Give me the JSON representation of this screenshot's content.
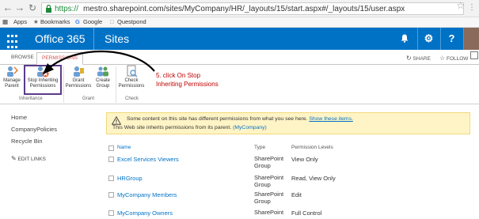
{
  "browser": {
    "url_scheme": "https://",
    "url_rest": "mestro.sharepoint.com/sites/MyCompany/HR/_layouts/15/start.aspx#/_layouts/15/user.aspx",
    "bookmarks": [
      "Apps",
      "Bookmarks",
      "Google",
      "Questpond"
    ]
  },
  "suite": {
    "app_name": "Office 365",
    "section": "Sites",
    "accent": "#0072c6"
  },
  "ribbon": {
    "tabs": [
      "BROWSE",
      "PERMISSIONS"
    ],
    "active_tab": "PERMISSIONS",
    "share": "SHARE",
    "follow": "FOLLOW",
    "buttons": {
      "manage_parent": [
        "Manage",
        "Parent"
      ],
      "stop_inheriting": [
        "Stop Inheriting",
        "Permissions"
      ],
      "grant": [
        "Grant",
        "Permissions"
      ],
      "create_group": [
        "Create",
        "Group"
      ],
      "check": [
        "Check",
        "Permissions"
      ]
    },
    "groups": [
      "Inheritance",
      "Grant",
      "Check"
    ]
  },
  "annotation": {
    "line1": "5. click On Stop",
    "line2": "Inheriting Permissions",
    "color": "#c00000"
  },
  "leftnav": {
    "items": [
      "Home",
      "CompanyPolicies",
      "Recycle Bin"
    ],
    "edit_links": "EDIT LINKS"
  },
  "message": {
    "line1": "Some content on this site has different permissions from what you see here.",
    "line1_link": "Show these items.",
    "line2": "This Web site inherits permissions from its parent.",
    "line2_link": "(MyCompany)"
  },
  "table": {
    "headers": [
      "Name",
      "Type",
      "Permission Levels"
    ],
    "rows": [
      {
        "name": "Excel Services Viewers",
        "type": [
          "SharePoint",
          "Group"
        ],
        "level": "View Only"
      },
      {
        "name": "HRGroup",
        "type": [
          "SharePoint",
          "Group"
        ],
        "level": "Read, View Only"
      },
      {
        "name": "MyCompany Members",
        "type": [
          "SharePoint",
          "Group"
        ],
        "level": "Edit"
      },
      {
        "name": "MyCompany Owners",
        "type": [
          "SharePoint",
          "Group"
        ],
        "level": "Full Control"
      }
    ]
  }
}
